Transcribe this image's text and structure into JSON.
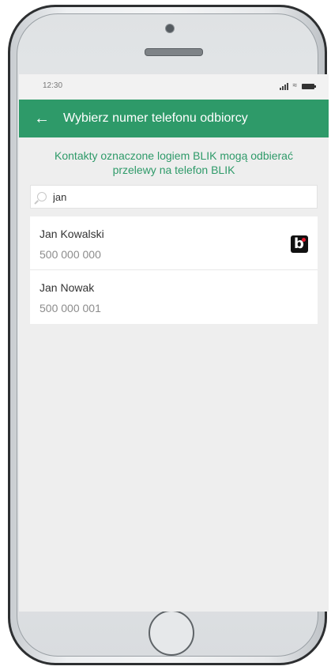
{
  "status_bar": {
    "time": "12:30",
    "icons": [
      "signal-icon",
      "wifi-icon",
      "battery-icon"
    ]
  },
  "header": {
    "back_icon": "arrow-left-icon",
    "title": "Wybierz numer telefonu odbiorcy"
  },
  "info": {
    "text": "Kontakty oznaczone logiem BLIK mogą odbierać przelewy na telefon BLIK"
  },
  "search": {
    "icon": "search-icon",
    "value": "jan",
    "placeholder": ""
  },
  "contacts": [
    {
      "name": "Jan Kowalski",
      "phone": "500 000 000",
      "blik": true
    },
    {
      "name": "Jan Nowak",
      "phone": "500 000 001",
      "blik": false
    }
  ],
  "colors": {
    "accent": "#2e9a69",
    "blik_badge": "#111111",
    "blik_dot": "#e3172d"
  }
}
